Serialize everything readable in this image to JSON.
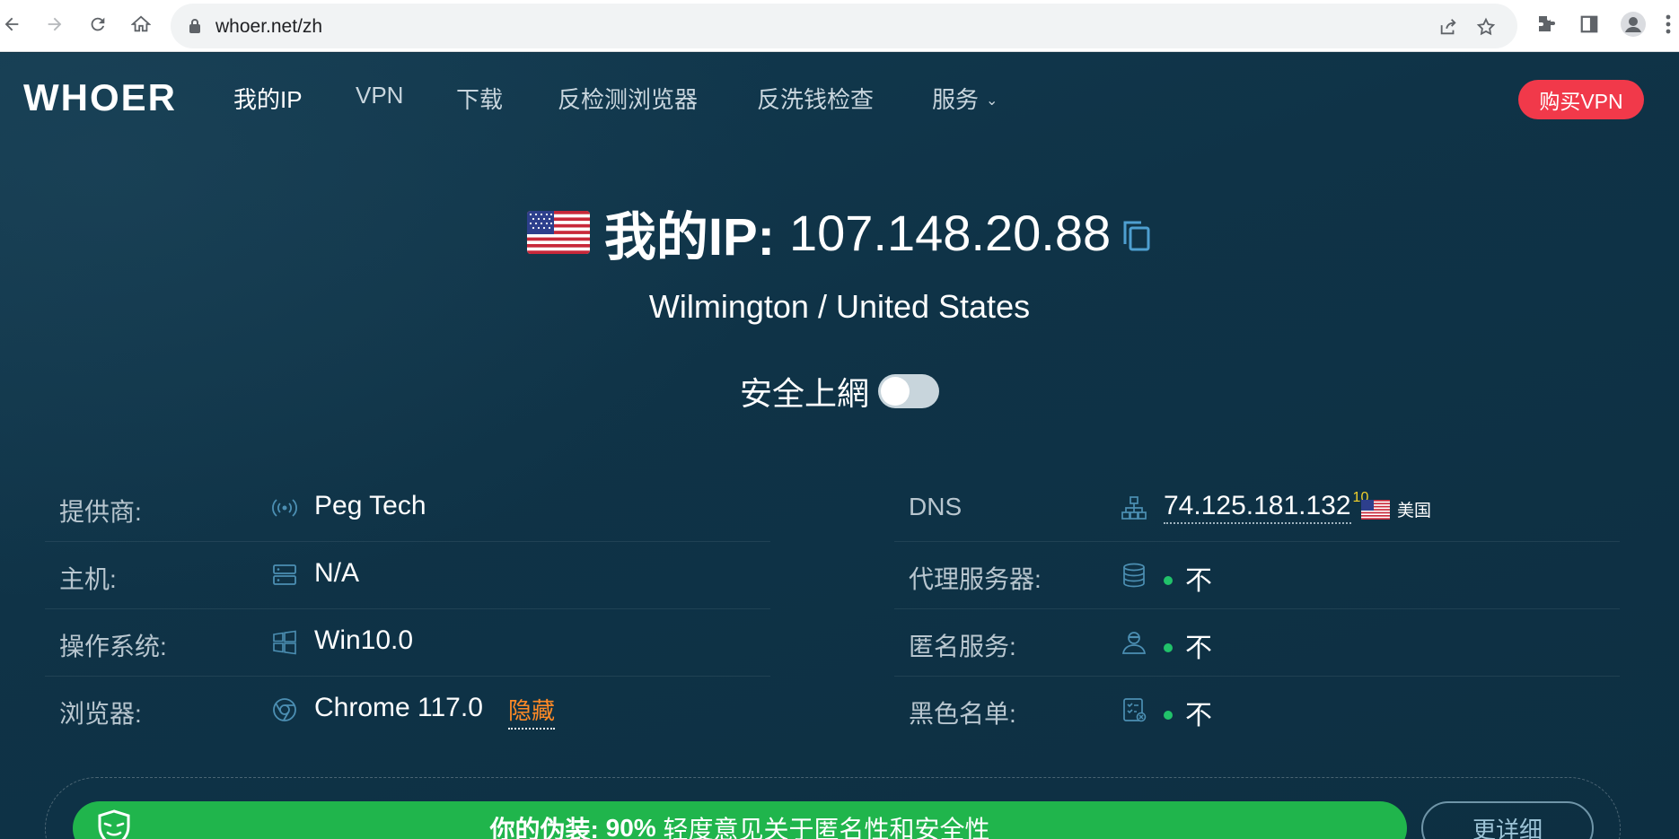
{
  "browser": {
    "url": "whoer.net/zh",
    "back_icon": "arrow-left-icon",
    "forward_icon": "arrow-right-icon",
    "reload_icon": "reload-icon",
    "home_icon": "home-icon"
  },
  "header": {
    "logo": "WHOER",
    "menu": [
      "我的IP",
      "VPN",
      "下载",
      "反检测浏览器",
      "反洗钱检查",
      "服务"
    ],
    "buy_button": "购买VPN"
  },
  "hero": {
    "ip_label": "我的IP:",
    "ip": "107.148.20.88",
    "location": "Wilmington / United States",
    "safe_label": "安全上網",
    "safe_toggle_on": false
  },
  "info": {
    "provider": {
      "label": "提供商:",
      "value": "Peg Tech"
    },
    "host": {
      "label": "主机:",
      "value": "N/A"
    },
    "os": {
      "label": "操作系统:",
      "value": "Win10.0"
    },
    "browser": {
      "label": "浏览器:",
      "value": "Chrome 117.0",
      "hide_link": "隐藏"
    },
    "dns": {
      "label": "DNS",
      "value": "74.125.181.132",
      "count": "10",
      "country": "美国"
    },
    "proxy": {
      "label": "代理服务器:",
      "value": "不"
    },
    "anonymizer": {
      "label": "匿名服务:",
      "value": "不"
    },
    "blacklist": {
      "label": "黑色名单:",
      "value": "不"
    }
  },
  "score": {
    "label": "你的伪装:",
    "percent": "90%",
    "text": "轻度意见关于匿名性和安全性",
    "more_button": "更详细"
  },
  "colors": {
    "background": "#0f3347",
    "buy": "#f1394a",
    "score_bar": "#20b54c",
    "status_dot": "#21c26a",
    "hide_link": "#ff8a26"
  }
}
